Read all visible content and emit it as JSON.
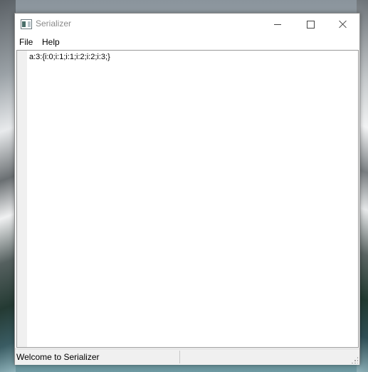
{
  "window": {
    "title": "Serializer"
  },
  "menubar": {
    "items": [
      {
        "label": "File"
      },
      {
        "label": "Help"
      }
    ]
  },
  "editor": {
    "content": "a:3:{i:0;i:1;i:1;i:2;i:2;i:3;}"
  },
  "statusbar": {
    "message": "Welcome to Serializer"
  },
  "icons": {
    "app": "serializer-app-icon",
    "minimize": "minimize-icon",
    "maximize": "maximize-icon",
    "close": "close-icon",
    "size_grip": "size-grip-icon"
  }
}
